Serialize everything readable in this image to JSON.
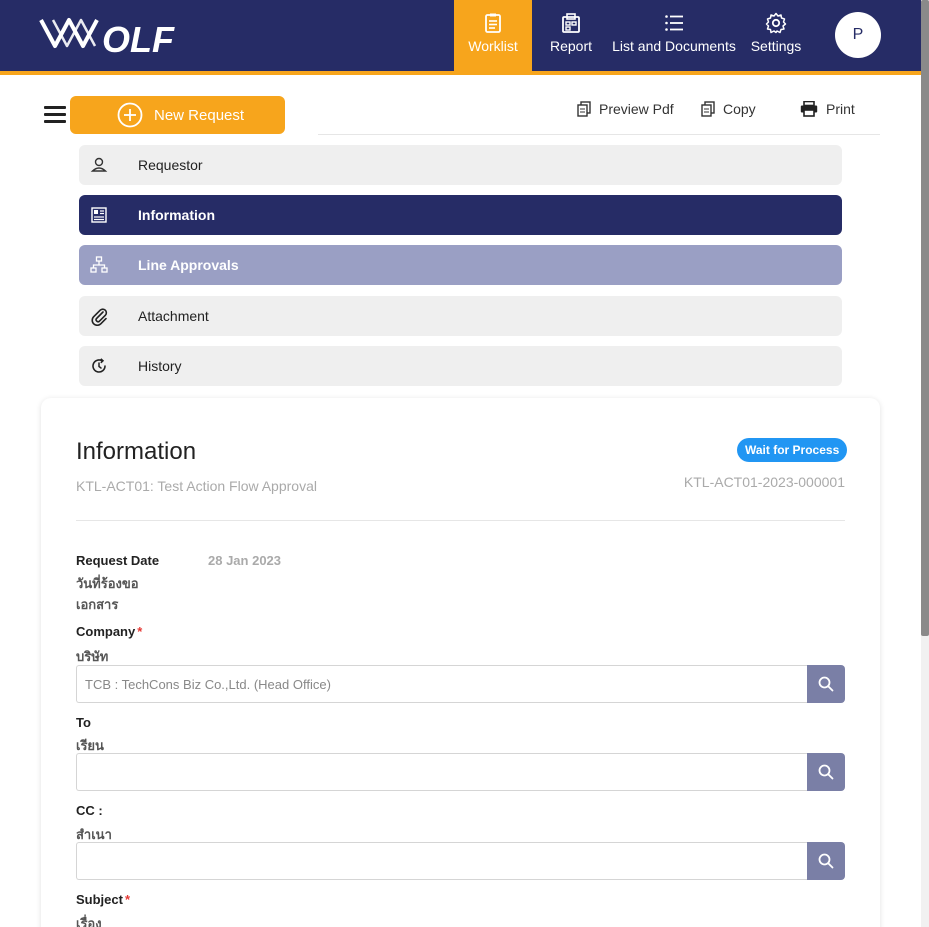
{
  "header": {
    "logo_text": "WOLF",
    "nav": [
      {
        "label": "Worklist",
        "icon": "clipboard-icon",
        "active": true
      },
      {
        "label": "Report",
        "icon": "report-icon",
        "active": false
      },
      {
        "label": "List and Documents",
        "icon": "list-icon",
        "active": false
      },
      {
        "label": "Settings",
        "icon": "gear-icon",
        "active": false
      }
    ],
    "avatar_initial": "P",
    "colors": {
      "primary": "#262c66",
      "accent": "#f7a51c"
    }
  },
  "toolbar": {
    "new_request_label": "New Request",
    "preview_pdf_label": "Preview Pdf",
    "copy_label": "Copy",
    "print_label": "Print"
  },
  "sections": [
    {
      "label": "Requestor",
      "icon": "user-icon",
      "state": "normal"
    },
    {
      "label": "Information",
      "icon": "document-icon",
      "state": "active"
    },
    {
      "label": "Line Approvals",
      "icon": "org-chart-icon",
      "state": "semi"
    },
    {
      "label": "Attachment",
      "icon": "paperclip-icon",
      "state": "normal"
    },
    {
      "label": "History",
      "icon": "history-icon",
      "state": "normal"
    }
  ],
  "card": {
    "title": "Information",
    "subtitle": "KTL-ACT01: Test Action Flow Approval",
    "status": "Wait for Process",
    "status_color": "#2196f3",
    "document_no": "KTL-ACT01-2023-000001",
    "fields": {
      "request_date": {
        "label": "Request Date",
        "label_th_1": "วันที่ร้องขอ",
        "label_th_2": "เอกสาร",
        "value": "28 Jan 2023"
      },
      "company": {
        "label": "Company",
        "label_th": "บริษัท",
        "value": "TCB : TechCons Biz Co.,Ltd. (Head Office)",
        "required": "*"
      },
      "to": {
        "label": "To",
        "label_th": "เรียน",
        "value": ""
      },
      "cc": {
        "label": "CC :",
        "label_th": "สำเนา",
        "value": ""
      },
      "subject": {
        "label": "Subject",
        "label_th": "เรื่อง",
        "required": "*"
      }
    }
  }
}
